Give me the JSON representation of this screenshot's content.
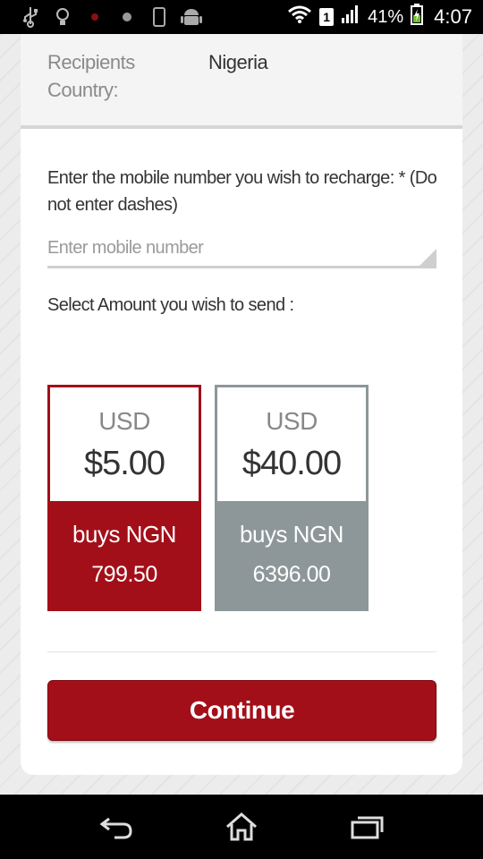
{
  "status_bar": {
    "battery_percent": "41%",
    "time": "4:07",
    "sim_slot": "1"
  },
  "recipient": {
    "label": "Recipients Country:",
    "value": "Nigeria"
  },
  "mobile": {
    "prompt": "Enter the mobile number you wish to recharge: * (Do not enter dashes)",
    "placeholder": "Enter mobile number",
    "value": ""
  },
  "amount": {
    "label": "Select Amount you wish to send :",
    "options": [
      {
        "currency": "USD",
        "value": "$5.00",
        "buys_label": "buys NGN",
        "receive": "799.50",
        "selected": true
      },
      {
        "currency": "USD",
        "value": "$40.00",
        "buys_label": "buys NGN",
        "receive": "6396.00",
        "selected": false
      }
    ]
  },
  "actions": {
    "continue_label": "Continue"
  },
  "colors": {
    "accent": "#a30f19",
    "unselected": "#8d9799"
  }
}
